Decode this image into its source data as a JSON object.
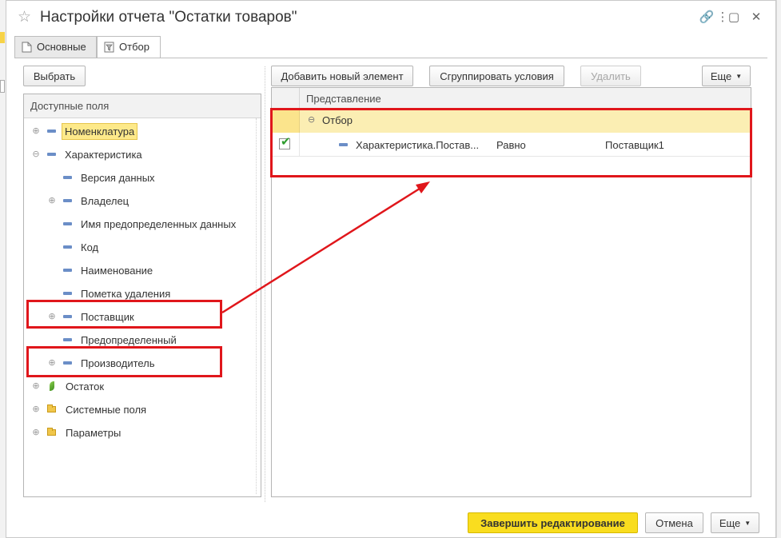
{
  "window": {
    "title": "Настройки отчета \"Остатки товаров\"",
    "controls": {
      "link": "🔗",
      "more": "⋮",
      "maximize": "▢",
      "close": "✕"
    }
  },
  "tabs": [
    {
      "label": "Основные",
      "icon": "document-icon",
      "active": false
    },
    {
      "label": "Отбор",
      "icon": "filter-icon",
      "active": true
    }
  ],
  "left": {
    "select_button": "Выбрать",
    "header": "Доступные поля",
    "tree": [
      {
        "label": "Номенклатура",
        "level": 0,
        "expander": "⊕",
        "icon": "dash",
        "highlighted": true
      },
      {
        "label": "Характеристика",
        "level": 0,
        "expander": "⊖",
        "icon": "dash"
      },
      {
        "label": "Версия данных",
        "level": 1,
        "expander": "",
        "icon": "dash"
      },
      {
        "label": "Владелец",
        "level": 1,
        "expander": "⊕",
        "icon": "dash"
      },
      {
        "label": "Имя предопределенных данных",
        "level": 1,
        "expander": "",
        "icon": "dash"
      },
      {
        "label": "Код",
        "level": 1,
        "expander": "",
        "icon": "dash"
      },
      {
        "label": "Наименование",
        "level": 1,
        "expander": "",
        "icon": "dash"
      },
      {
        "label": "Пометка удаления",
        "level": 1,
        "expander": "",
        "icon": "dash"
      },
      {
        "label": "Поставщик",
        "level": 1,
        "expander": "⊕",
        "icon": "dash"
      },
      {
        "label": "Предопределенный",
        "level": 1,
        "expander": "",
        "icon": "dash"
      },
      {
        "label": "Производитель",
        "level": 1,
        "expander": "⊕",
        "icon": "dash"
      },
      {
        "label": "Остаток",
        "level": 0,
        "expander": "⊕",
        "icon": "leaf"
      },
      {
        "label": "Системные поля",
        "level": 0,
        "expander": "⊕",
        "icon": "folder"
      },
      {
        "label": "Параметры",
        "level": 0,
        "expander": "⊕",
        "icon": "folder"
      }
    ]
  },
  "right": {
    "add_button": "Добавить новый элемент",
    "group_button": "Сгруппировать условия",
    "delete_button": "Удалить",
    "more_button": "Еще",
    "header": "Представление",
    "group": {
      "expander": "⊖",
      "label": "Отбор"
    },
    "item": {
      "checked": true,
      "checkmark": "✔",
      "field": "Характеристика.Постав...",
      "comparison": "Равно",
      "value": "Поставщик1"
    }
  },
  "footer": {
    "finish_button": "Завершить редактирование",
    "cancel_button": "Отмена",
    "more_button": "Еще"
  },
  "annotation_color": "#e0161b",
  "accent_color": "#f9dd1f"
}
